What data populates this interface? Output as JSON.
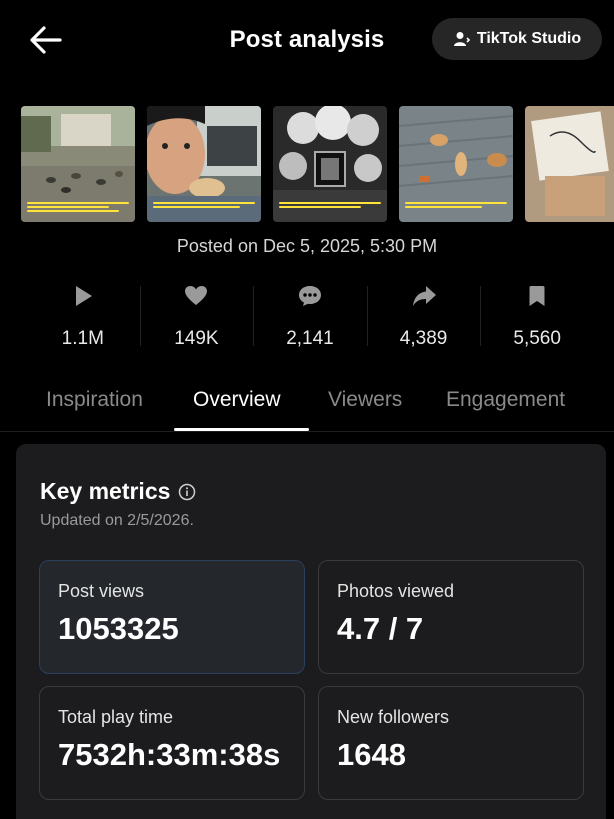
{
  "header": {
    "title": "Post analysis",
    "studio_label": "TikTok Studio"
  },
  "thumbnails": [
    {
      "name": "street-cats-thumbnail"
    },
    {
      "name": "boy-selfie-thumbnail"
    },
    {
      "name": "funeral-flowers-thumbnail"
    },
    {
      "name": "cats-on-deck-thumbnail"
    },
    {
      "name": "sketch-photo-thumbnail"
    }
  ],
  "posted": "Posted on Dec 5, 2025, 5:30 PM",
  "stats": [
    {
      "icon": "play-icon",
      "value": "1.1M"
    },
    {
      "icon": "heart-icon",
      "value": "149K"
    },
    {
      "icon": "comment-icon",
      "value": "2,141"
    },
    {
      "icon": "share-icon",
      "value": "4,389"
    },
    {
      "icon": "bookmark-icon",
      "value": "5,560"
    }
  ],
  "tabs": [
    "Inspiration",
    "Overview",
    "Viewers",
    "Engagement"
  ],
  "active_tab": "Overview",
  "key_metrics": {
    "title": "Key metrics",
    "updated": "Updated on 2/5/2026.",
    "items": [
      {
        "label": "Post views",
        "value": "1053325"
      },
      {
        "label": "Photos viewed",
        "value": "4.7 / 7"
      },
      {
        "label": "Total play time",
        "value": "7532h:33m:38s"
      },
      {
        "label": "New followers",
        "value": "1648"
      }
    ]
  },
  "colors": {
    "background": "#000000",
    "card": "#1c1c1e",
    "caption_yellow": "#ffe23a"
  }
}
